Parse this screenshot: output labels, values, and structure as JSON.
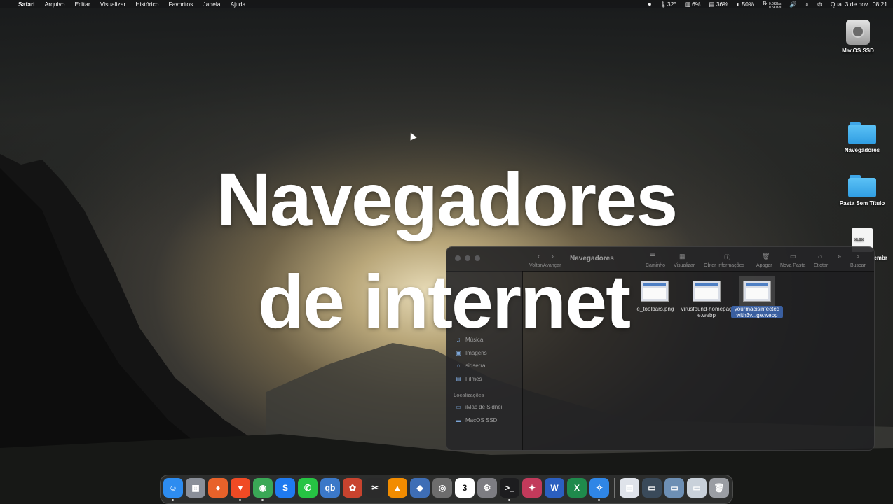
{
  "menubar": {
    "apple": "",
    "app": "Safari",
    "menus": [
      "Arquivo",
      "Editar",
      "Visualizar",
      "Histórico",
      "Favoritos",
      "Janela",
      "Ajuda"
    ],
    "status": {
      "temperature": "32°",
      "cpu": "6%",
      "memory": "36%",
      "net_up": "0.0KB/s",
      "net_down": "0.5KB/s",
      "battery": "50%",
      "datetime": "Qua. 3 de nov.",
      "time": "08:21"
    }
  },
  "desktop": {
    "icons": [
      {
        "label": "MacOS SSD",
        "type": "disk"
      },
      {
        "label": "Navegadores",
        "type": "folder"
      },
      {
        "label": "Pasta Sem Título",
        "type": "folder"
      },
      {
        "label": "embr",
        "type": "xlsx",
        "badge": "XLSX"
      }
    ]
  },
  "overlay": {
    "line1": "Navegadores",
    "line2": "de internet"
  },
  "finder": {
    "title": "Navegadores",
    "toolbar": {
      "back_forward": "Voltar/Avançar",
      "path": "Caminho",
      "view": "Visualizar",
      "info": "Obter Informações",
      "delete": "Apagar",
      "new_folder": "Nova Pasta",
      "edit": "Etiqtar",
      "search": "Buscar"
    },
    "sidebar": {
      "items": [
        {
          "label": "Música",
          "icon": "music-icon"
        },
        {
          "label": "Imagens",
          "icon": "images-icon"
        },
        {
          "label": "sidserra",
          "icon": "home-icon"
        },
        {
          "label": "Filmes",
          "icon": "movies-icon"
        }
      ],
      "locations_header": "Localizações",
      "locations": [
        {
          "label": "iMac de Sidnei",
          "icon": "computer-icon"
        },
        {
          "label": "MacOS SSD",
          "icon": "disk-icon"
        }
      ]
    },
    "files": [
      {
        "name": "ie_toolbars.png"
      },
      {
        "name": "virusfound-homepage.webp"
      },
      {
        "name": "yourmacisinfectedwith3v...ge.webp",
        "selected": true
      }
    ]
  },
  "dock": {
    "apps": [
      {
        "name": "Finder",
        "color": "#2d8cf0",
        "glyph": "☺"
      },
      {
        "name": "Launchpad",
        "color": "#8a8f99",
        "glyph": "▦"
      },
      {
        "name": "Firefox",
        "color": "#e8622a",
        "glyph": "●"
      },
      {
        "name": "Brave",
        "color": "#f04a24",
        "glyph": "▼"
      },
      {
        "name": "Chrome",
        "color": "#3aa856",
        "glyph": "◉"
      },
      {
        "name": "Shazam",
        "color": "#1f7af0",
        "glyph": "S"
      },
      {
        "name": "WhatsApp",
        "color": "#26c443",
        "glyph": "✆"
      },
      {
        "name": "qBittorrent",
        "color": "#3b78c8",
        "glyph": "qb"
      },
      {
        "name": "CrossOver",
        "color": "#c8432e",
        "glyph": "✿"
      },
      {
        "name": "Final Cut",
        "color": "#2b2b2b",
        "glyph": "✂"
      },
      {
        "name": "VLC",
        "color": "#f28c00",
        "glyph": "▲"
      },
      {
        "name": "VirtualBox",
        "color": "#3e6eb6",
        "glyph": "◆"
      },
      {
        "name": "Screenshot",
        "color": "#6d6d6d",
        "glyph": "◎"
      },
      {
        "name": "Calendar",
        "color": "#ffffff",
        "glyph": "3"
      },
      {
        "name": "System Preferences",
        "color": "#7d7d82",
        "glyph": "⚙"
      },
      {
        "name": "Terminal",
        "color": "#1d1d1f",
        "glyph": ">_"
      },
      {
        "name": "CleanMyMac",
        "color": "#c23a5b",
        "glyph": "✦"
      },
      {
        "name": "Word",
        "color": "#2b5fc0",
        "glyph": "W"
      },
      {
        "name": "Excel",
        "color": "#1f8a4c",
        "glyph": "X"
      },
      {
        "name": "Safari",
        "color": "#2f86e6",
        "glyph": "✧"
      }
    ],
    "stack": [
      {
        "name": "Documents",
        "color": "#dfe3ea",
        "glyph": "▤"
      },
      {
        "name": "Recent 1",
        "color": "#3a4a5a",
        "glyph": "▭"
      },
      {
        "name": "Recent 2",
        "color": "#6d8fb4",
        "glyph": "▭"
      },
      {
        "name": "Recent 3",
        "color": "#c9d1da",
        "glyph": "▭"
      },
      {
        "name": "Trash",
        "color": "#9a9da3",
        "glyph": "🗑"
      }
    ]
  }
}
